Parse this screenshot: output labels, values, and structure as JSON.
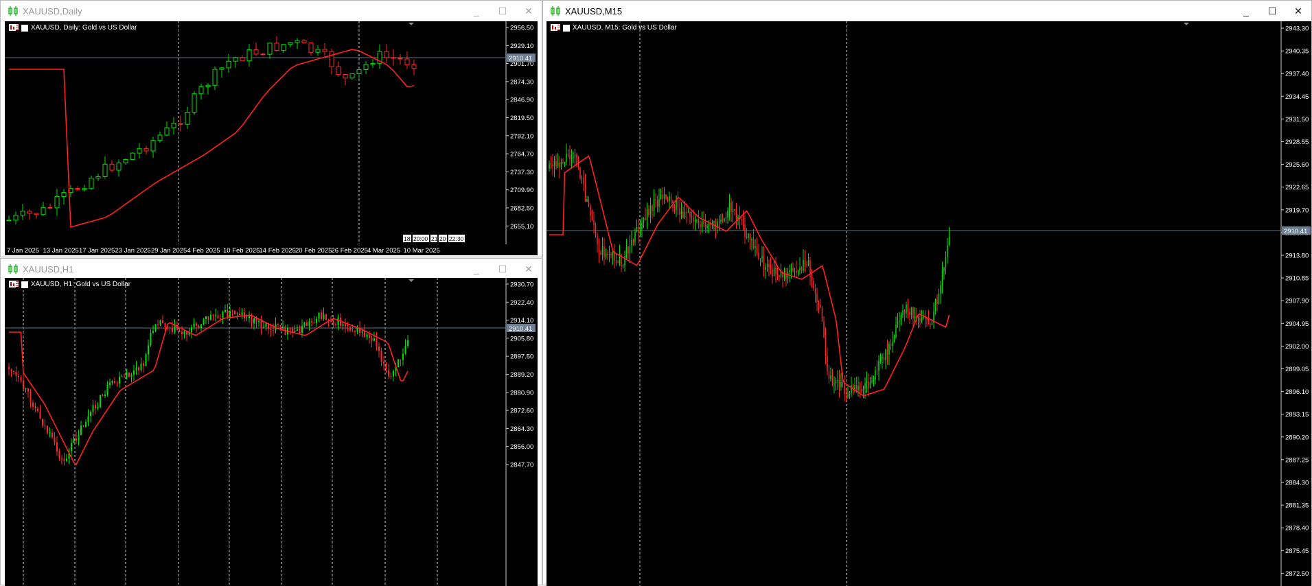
{
  "colors": {
    "bg": "#000000",
    "bull": "#00e000",
    "bear": "#ff2828",
    "ma": "#ff2020",
    "grid": "#c8c8c8",
    "axis": "#c8c8c8",
    "priceLine": "#5f6f80",
    "priceBox": "#6e7f93",
    "icon_green": "#27b327"
  },
  "windows": {
    "daily": {
      "title": "XAUUSD,Daily",
      "subtitle": "XAUUSD, Daily:  Gold vs US Dollar",
      "price": "2910.41",
      "yticks": [
        "2956.50",
        "2929.10",
        "2901.70",
        "2874.30",
        "2846.90",
        "2819.50",
        "2792.10",
        "2764.70",
        "2737.30",
        "2709.90",
        "2682.50",
        "2655.10"
      ],
      "xticks": [
        "7 Jan 2025",
        "13 Jan 2025",
        "17 Jan 2025",
        "23 Jan 2025",
        "29 Jan 2025",
        "4 Feb 2025",
        "10 Feb 2025",
        "14 Feb 2025",
        "20 Feb 2025",
        "26 Feb 2025",
        "4 Mar 2025",
        "10 Mar 2025"
      ],
      "timeboxes": [
        "18:",
        "20:00",
        "21",
        "20",
        "22:30"
      ]
    },
    "h1": {
      "title": "XAUUSD,H1",
      "subtitle": "XAUUSD, H1:  Gold vs US Dollar",
      "price": "2910.41",
      "yticks": [
        "2930.70",
        "2922.40",
        "2914.10",
        "2905.80",
        "2897.50",
        "2889.20",
        "2880.90",
        "2872.60",
        "2864.30",
        "2856.00",
        "2847.70"
      ]
    },
    "m15": {
      "title": "XAUUSD,M15",
      "subtitle": "XAUUSD, M15:  Gold vs US Dollar",
      "price": "2910.41",
      "yticks": [
        "2943.30",
        "2940.35",
        "2937.40",
        "2934.45",
        "2931.50",
        "2928.55",
        "2925.60",
        "2922.65",
        "2919.70",
        "2916.75",
        "2913.80",
        "2910.85",
        "2907.90",
        "2904.95",
        "2902.00",
        "2899.05",
        "2896.10",
        "2893.15",
        "2890.20",
        "2887.25",
        "2884.30",
        "2881.35",
        "2878.40",
        "2875.45",
        "2872.50"
      ]
    }
  },
  "controls": {
    "minimize": "_",
    "maximize": "☐",
    "close": "✕"
  },
  "icons": {
    "chart_title": "candlestick-chart-icon",
    "flag": "us-flag-icon",
    "symbol_tool": "chart-symbol-icon"
  }
}
